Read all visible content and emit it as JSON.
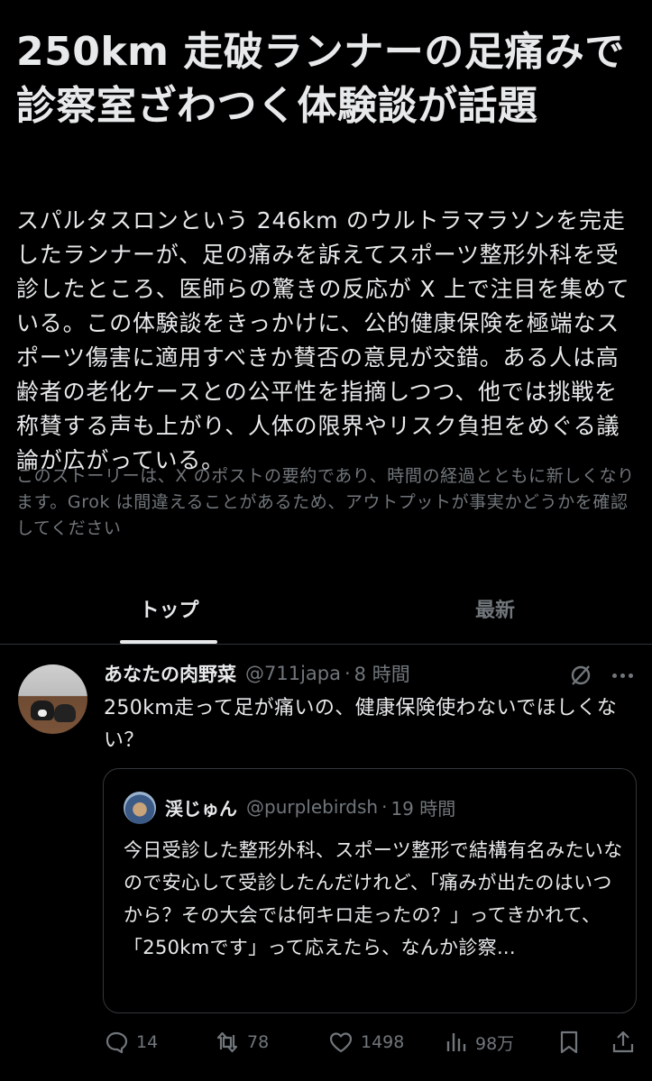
{
  "story": {
    "title": "250km 走破ランナーの足痛みで診察室ざわつく体験談が話題",
    "summary": "スパルタスロンという 246km のウルトラマラソンを完走したランナーが、足の痛みを訴えてスポーツ整形外科を受診したところ、医師らの驚きの反応が X 上で注目を集めている。この体験談をきっかけに、公的健康保険を極端なスポーツ傷害に適用すべきか賛否の意見が交錯。ある人は高齢者の老化ケースとの公平性を指摘しつつ、他では挑戦を称賛する声も上がり、人体の限界やリスク負担をめぐる議論が広がっている。",
    "disclaimer": "このストーリーは、X のポストの要約であり、時間の経過とともに新しくなります。Grok は間違えることがあるため、アウトプットが事実かどうかを確認してください"
  },
  "tabs": [
    {
      "label": "トップ",
      "active": true
    },
    {
      "label": "最新",
      "active": false
    }
  ],
  "post": {
    "author_name": "あなたの肉野菜",
    "handle": "@711japa",
    "separator": "·",
    "time": "8 時間",
    "text": "250km走って足が痛いの、健康保険使わないでほしくない？",
    "quote": {
      "author_name": "渓じゅん",
      "handle": "@purplebirdsh",
      "separator": "·",
      "time": "19 時間",
      "text": "今日受診した整形外科、スポーツ整形で結構有名みたいなので安心して受診したんだけれど、「痛みが出たのはいつから？その大会では何キロ走ったの？」ってきかれて、「250kmです」って応えたら、なんか診察..."
    },
    "actions": {
      "replies": "14",
      "reposts": "78",
      "likes": "1498",
      "views": "98万"
    }
  },
  "colors": {
    "background": "#000000",
    "text": "#e7e9ea",
    "muted": "#71767b",
    "border": "#2f3336"
  }
}
